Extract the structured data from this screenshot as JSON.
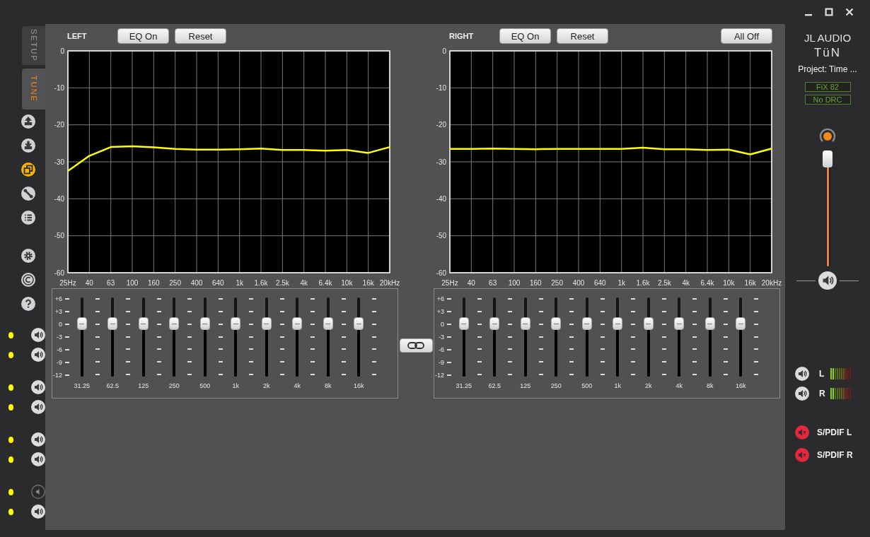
{
  "sidebar": {
    "tabs": [
      {
        "label": "SETUP",
        "selected": false
      },
      {
        "label": "TUNE",
        "selected": true
      }
    ],
    "tool_groups": [
      {
        "tools": [
          {
            "kind": "upload",
            "selected": false
          },
          {
            "kind": "download",
            "selected": false
          },
          {
            "kind": "copy",
            "selected": true
          },
          {
            "kind": "wrench",
            "selected": false
          },
          {
            "kind": "list",
            "selected": false
          }
        ]
      },
      {
        "tools": [
          {
            "kind": "gear",
            "selected": false
          },
          {
            "kind": "copyright",
            "selected": false
          },
          {
            "kind": "help",
            "selected": false
          }
        ]
      }
    ],
    "channel_groups": [
      {
        "channels": [
          {
            "on": true
          },
          {
            "on": true
          }
        ]
      },
      {
        "channels": [
          {
            "on": true
          },
          {
            "on": true
          }
        ]
      },
      {
        "channels": [
          {
            "on": true
          },
          {
            "on": true
          }
        ]
      },
      {
        "channels": [
          {
            "on": false
          },
          {
            "on": true
          }
        ]
      }
    ]
  },
  "eq": [
    {
      "title": "LEFT",
      "buttons": [
        "EQ On",
        "Reset"
      ],
      "chart_data": {
        "type": "line",
        "categories": [
          "25Hz",
          "40",
          "63",
          "100",
          "160",
          "250",
          "400",
          "640",
          "1k",
          "1.6k",
          "2.5k",
          "4k",
          "6.4k",
          "10k",
          "16k",
          "20kHz"
        ],
        "grid": true,
        "series": [
          {
            "color": "#ffff00",
            "values": [
              -32.5,
              -28.4,
              -26.0,
              -25.8,
              -26.1,
              -26.5,
              -26.7,
              -26.7,
              -26.6,
              -26.4,
              -26.8,
              -26.8,
              -27.0,
              -26.8,
              -27.6,
              -26.0
            ]
          }
        ],
        "ylim": [
          -60,
          0
        ],
        "yticks": [
          0,
          -10,
          -20,
          -30,
          -40,
          -50,
          -60
        ]
      },
      "scale": [
        "+6",
        "+3",
        "0",
        "-3",
        "-6",
        "-9",
        "-12"
      ],
      "bands": [
        {
          "label": "31.25",
          "level": 0.667
        },
        {
          "label": "62.5",
          "level": 0.667
        },
        {
          "label": "125",
          "level": 0.667
        },
        {
          "label": "250",
          "level": 0.667
        },
        {
          "label": "500",
          "level": 0.667
        },
        {
          "label": "1k",
          "level": 0.667
        },
        {
          "label": "2k",
          "level": 0.667
        },
        {
          "label": "4k",
          "level": 0.667
        },
        {
          "label": "8k",
          "level": 0.667
        },
        {
          "label": "16k",
          "level": 0.667
        }
      ]
    },
    {
      "title": "RIGHT",
      "buttons": [
        "EQ On",
        "Reset"
      ],
      "aside_button": "All Off",
      "chart_data": {
        "type": "line",
        "categories": [
          "25Hz",
          "40",
          "63",
          "100",
          "160",
          "250",
          "400",
          "640",
          "1k",
          "1.6k",
          "2.5k",
          "4k",
          "6.4k",
          "10k",
          "16k",
          "20kHz"
        ],
        "grid": true,
        "series": [
          {
            "color": "#ffff00",
            "values": [
              -26.5,
              -26.5,
              -26.4,
              -26.5,
              -26.6,
              -26.5,
              -26.5,
              -26.5,
              -26.5,
              -26.2,
              -26.6,
              -26.6,
              -26.8,
              -26.7,
              -28.0,
              -26.4
            ]
          }
        ],
        "ylim": [
          -60,
          0
        ],
        "yticks": [
          0,
          -10,
          -20,
          -30,
          -40,
          -50,
          -60
        ]
      },
      "scale": [
        "+6",
        "+3",
        "0",
        "-3",
        "-6",
        "-9",
        "-12"
      ],
      "bands": [
        {
          "label": "31.25",
          "level": 0.667
        },
        {
          "label": "62.5",
          "level": 0.667
        },
        {
          "label": "125",
          "level": 0.667
        },
        {
          "label": "250",
          "level": 0.667
        },
        {
          "label": "500",
          "level": 0.667
        },
        {
          "label": "1k",
          "level": 0.667
        },
        {
          "label": "2k",
          "level": 0.667
        },
        {
          "label": "4k",
          "level": 0.667
        },
        {
          "label": "8k",
          "level": 0.667
        },
        {
          "label": "16k",
          "level": 0.667
        }
      ]
    }
  ],
  "brand": {
    "logo": "JL AUDIO",
    "product": "TüN"
  },
  "project": "Project: Time ...",
  "badges": [
    "FiX 82",
    "No DRC"
  ],
  "master": {
    "level": 0.93
  },
  "meters": [
    {
      "label": "L",
      "level": 0.2
    },
    {
      "label": "R",
      "level": 0.2
    }
  ],
  "outputs": [
    {
      "label": "S/PDIF L",
      "muted": true
    },
    {
      "label": "S/PDIF R",
      "muted": true
    }
  ]
}
